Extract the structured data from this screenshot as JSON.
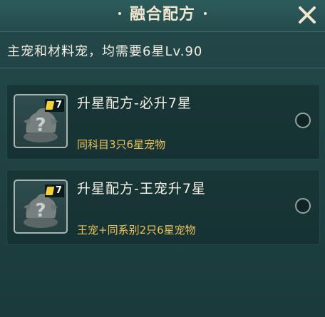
{
  "header": {
    "title": "融合配方",
    "close_icon": "close-x-icon"
  },
  "subtitle": "主宠和材料宠，均需要6星Lv.90",
  "recipes": [
    {
      "title": "升星配方-必升7星",
      "description": "同科目3只6星宠物",
      "badge_count": "7",
      "icon": "unknown-pet-question-icon",
      "selected": false
    },
    {
      "title": "升星配方-王宠升7星",
      "description": "王宠+同系别2只6星宠物",
      "badge_count": "7",
      "icon": "unknown-pet-question-icon",
      "selected": false
    }
  ],
  "colors": {
    "title": "#f1e6cf",
    "description": "#e9c35a",
    "background": "#1f4142",
    "badge_star": "#f3d23a"
  }
}
